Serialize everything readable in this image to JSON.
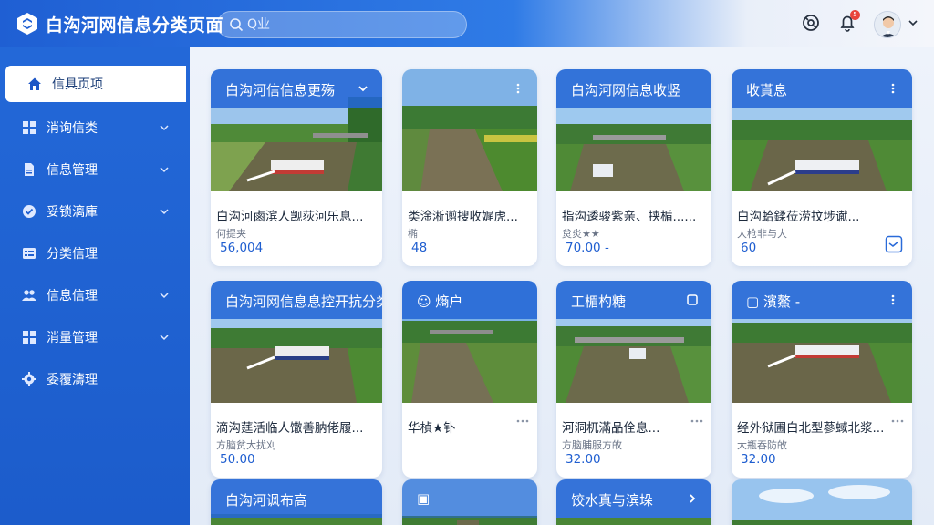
{
  "header": {
    "title": "白沟河网信息分类页面",
    "search_placeholder": "Q业",
    "notification_count": "5"
  },
  "sidebar": {
    "items": [
      {
        "label": "信具页项",
        "icon": "home-icon",
        "active": true,
        "expandable": false
      },
      {
        "label": "消询信类",
        "icon": "grid-icon",
        "active": false,
        "expandable": true
      },
      {
        "label": "信息管理",
        "icon": "document-icon",
        "active": false,
        "expandable": true
      },
      {
        "label": "妥锁漓庫",
        "icon": "check-circle-icon",
        "active": false,
        "expandable": true
      },
      {
        "label": "分类信理",
        "icon": "list-icon",
        "active": false,
        "expandable": false
      },
      {
        "label": "信息信理",
        "icon": "users-icon",
        "active": false,
        "expandable": true
      },
      {
        "label": "消量管理",
        "icon": "grid-icon",
        "active": false,
        "expandable": true
      },
      {
        "label": "委覆濤理",
        "icon": "gear-icon",
        "active": false,
        "expandable": false
      }
    ]
  },
  "cards": [
    {
      "banner": "白沟河信信息更殇",
      "banner_icon": "chevron-down-icon",
      "title": "白沟河鹵滨人觊荻河乐息...",
      "sub": "何提夹",
      "num": "56,004",
      "photo": "boat"
    },
    {
      "banner": "",
      "banner_icon": "dots-vertical-icon",
      "title": "类淦淅谫搜收娓虎...",
      "sub": "椭",
      "num": "48",
      "photo": "canal"
    },
    {
      "banner": "白沟河网信息收竖",
      "banner_icon": "",
      "title": "指沟逶骏紫亲、挟楯......",
      "sub": "炱炎★★",
      "num": "70.00 -",
      "photo": "bridge"
    },
    {
      "banner": "收貰息",
      "banner_icon": "dots-vertical-icon",
      "title": "白沟蛤鍒莅涝抆埗谳...",
      "sub": "大枪非与大",
      "num": "60",
      "photo": "boat2"
    },
    {
      "banner": "白沟河网信息息控开抗分类",
      "banner_icon": "",
      "title": "滴沟莛活临人馓善肭佬履...",
      "sub": "方脑贫大扰刈",
      "num": "50.00",
      "photo": "boat"
    },
    {
      "banner": "☺ 熵户",
      "banner_icon": "",
      "title": "华楨★钋",
      "sub": "",
      "num": "",
      "photo": "canal2"
    },
    {
      "banner": "工楣杓糖",
      "banner_icon": "square-icon",
      "title": "河洞杌滿品佺息...",
      "sub": "方脑脯服方敀",
      "num": "32.00",
      "photo": "bridge2"
    },
    {
      "banner": "▢ 濱鰲 -",
      "banner_icon": "dots-vertical-icon",
      "title": "经外狱圃白北型蔘蜮北浆...",
      "sub": "大瓶吞防敀",
      "num": "32.00",
      "photo": "boat3"
    },
    {
      "banner": "白沟河讽布高",
      "banner_icon": "",
      "title": "",
      "sub": "",
      "num": "",
      "photo": "field"
    },
    {
      "banner": "▣",
      "banner_icon": "",
      "title": "",
      "sub": "",
      "num": "",
      "photo": "canal3"
    },
    {
      "banner": "饺水真与滨垛",
      "banner_icon": "chevron-right-icon",
      "title": "",
      "sub": "",
      "num": "",
      "photo": "field2"
    },
    {
      "banner": "",
      "banner_icon": "",
      "title": "",
      "sub": "",
      "num": "",
      "photo": "sky"
    }
  ],
  "colors": {
    "primary": "#1f5fd0",
    "accent": "#2a6bd9",
    "badge": "#e8453c"
  }
}
